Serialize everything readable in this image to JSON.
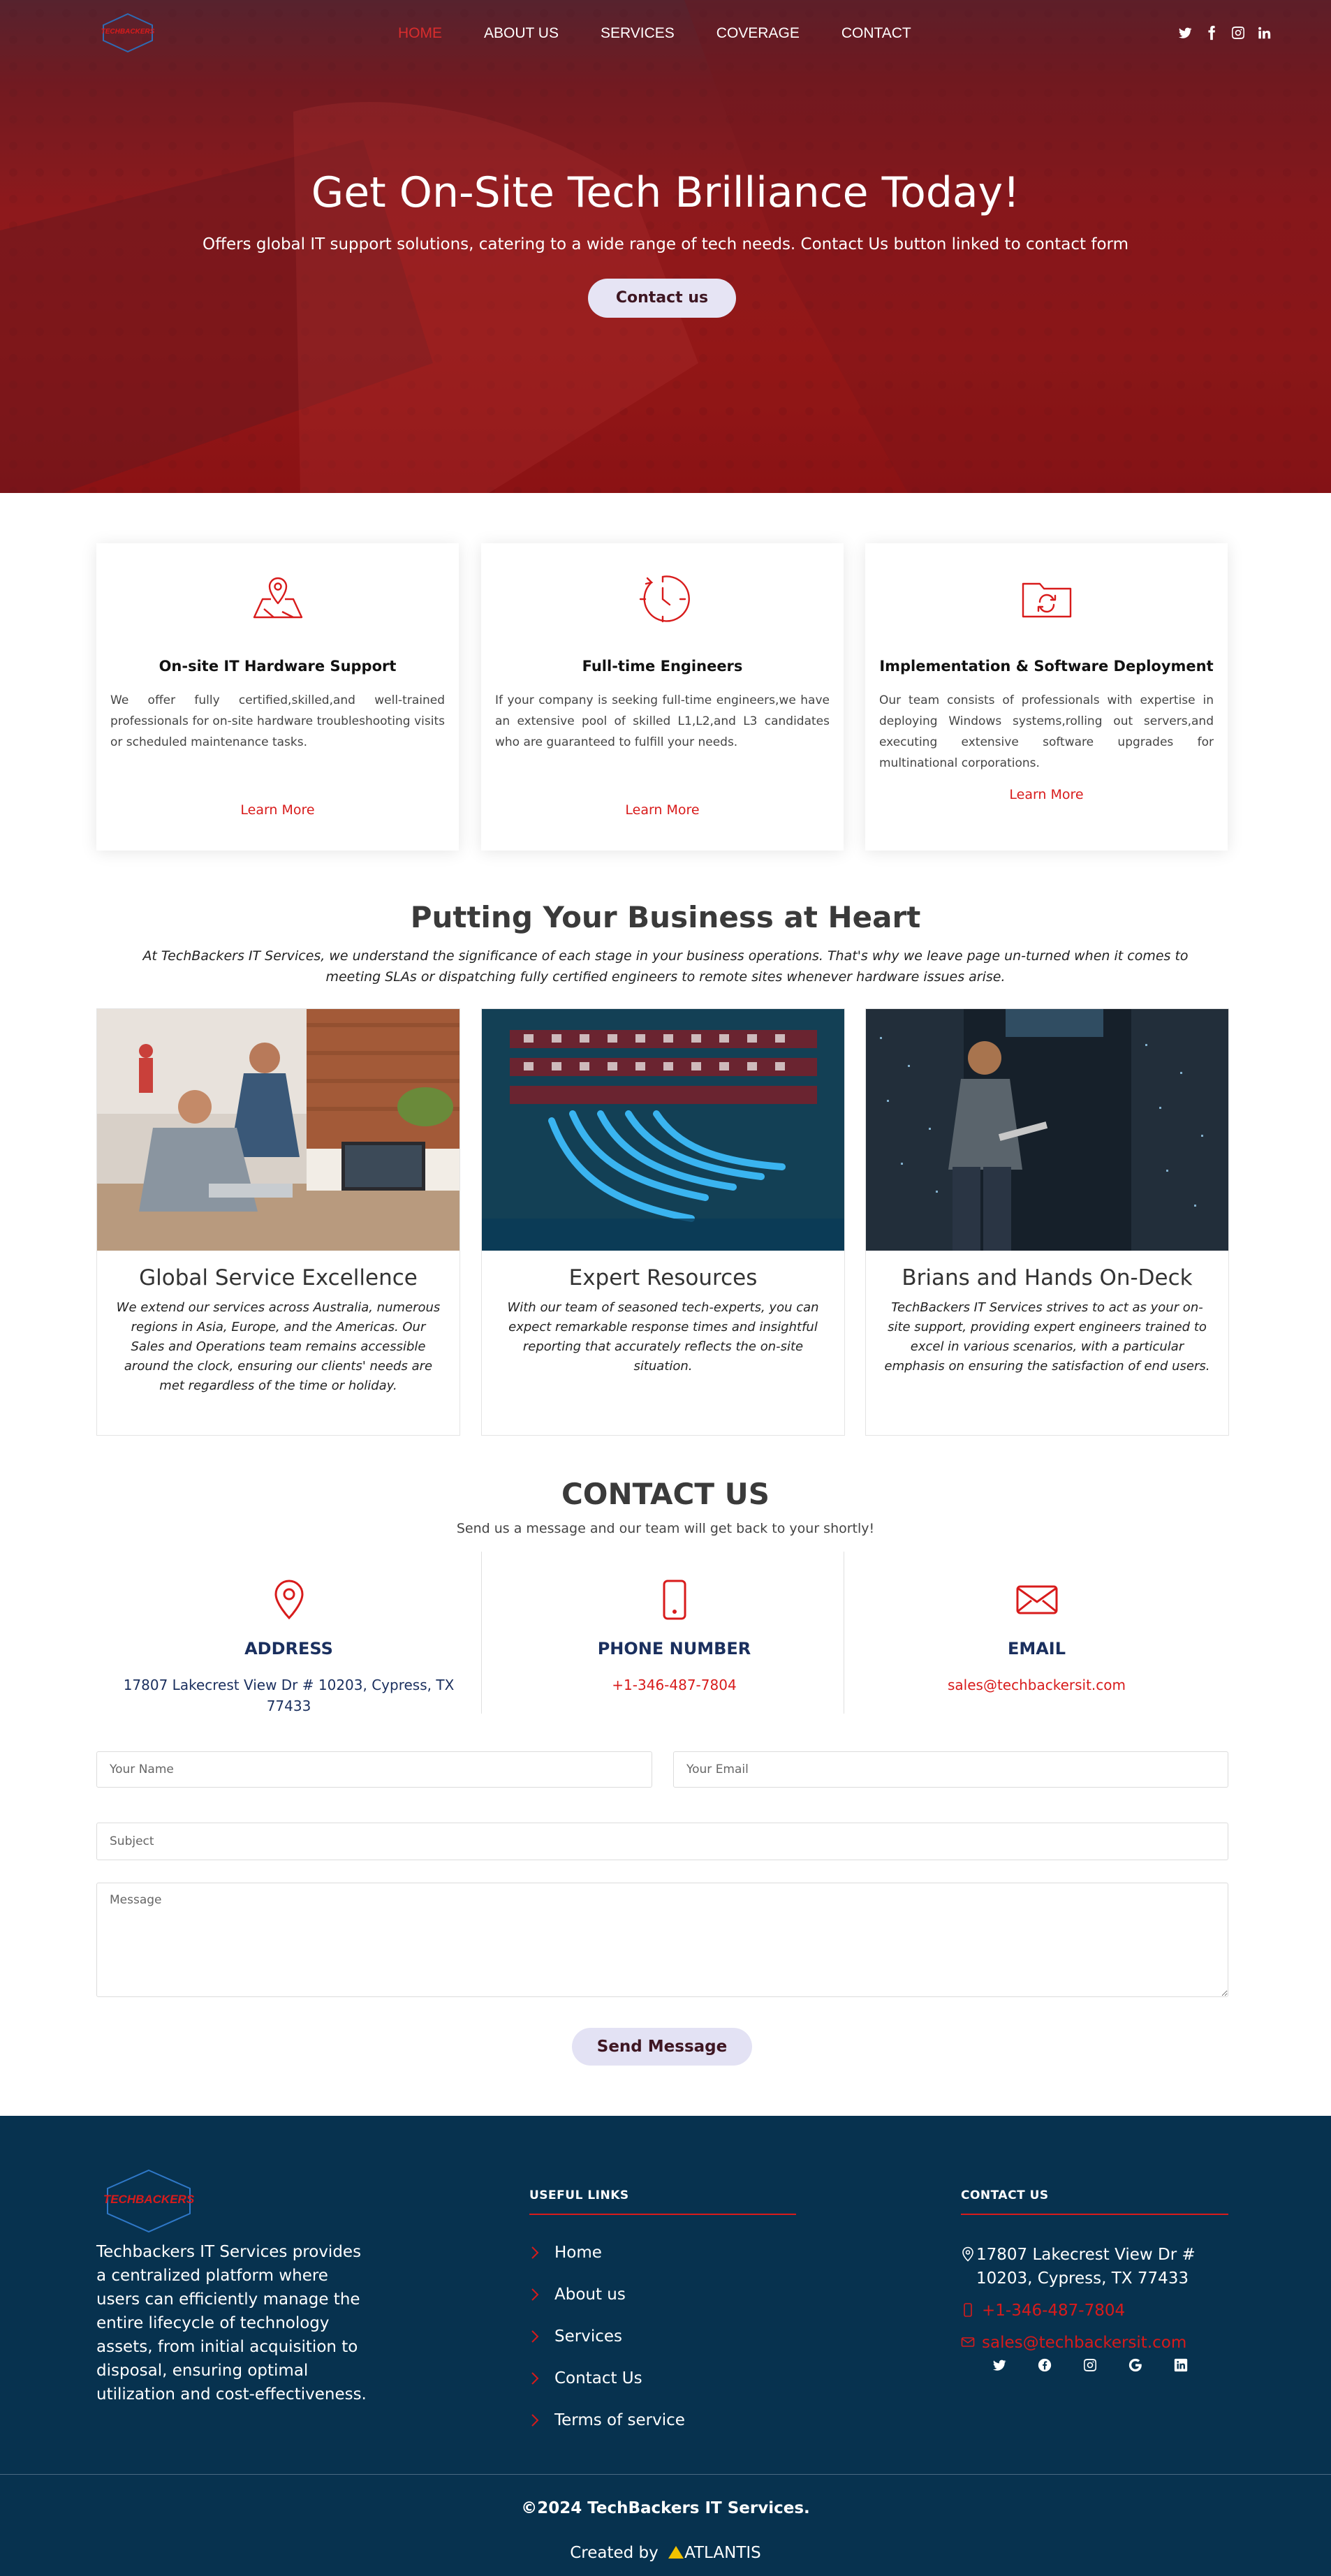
{
  "nav": {
    "logo_text": "TECHBACKERS",
    "items": [
      {
        "label": "HOME",
        "active": true
      },
      {
        "label": "ABOUT US",
        "active": false
      },
      {
        "label": "SERVICES",
        "active": false
      },
      {
        "label": "COVERAGE",
        "active": false
      },
      {
        "label": "CONTACT",
        "active": false
      }
    ],
    "social_icons": [
      "twitter-icon",
      "facebook-icon",
      "instagram-icon",
      "linkedin-icon"
    ]
  },
  "hero": {
    "title": "Get On-Site Tech Brilliance Today!",
    "subtitle": "Offers global IT support solutions, catering to a wide range of tech needs. Contact Us button linked to contact form",
    "button": "Contact us"
  },
  "services": [
    {
      "icon": "map-pin-icon",
      "title": "On-site IT Hardware Support",
      "text": "We offer fully certified,skilled,and well-trained professionals for on-site hardware troubleshooting visits or scheduled maintenance tasks.",
      "link": "Learn More"
    },
    {
      "icon": "clock-icon",
      "title": "Full-time Engineers",
      "text": "If your company is seeking full-time engineers,we have an extensive pool of skilled L1,L2,and L3 candidates who are guaranteed to fulfill your needs.",
      "link": "Learn More"
    },
    {
      "icon": "folder-sync-icon",
      "title": "Implementation & Software Deployment",
      "text": "Our team consists of professionals with expertise in deploying Windows systems,rolling out servers,and executing extensive software upgrades for multinational corporations.",
      "link": "Learn More"
    }
  ],
  "heart": {
    "title": "Putting Your Business at Heart",
    "description": "At TechBackers IT Services, we understand the significance of each stage in your business operations. That's why we leave page un-turned when it comes to meeting SLAs or dispatching fully certified engineers to remote sites whenever hardware issues arise.",
    "features": [
      {
        "title": "Global Service Excellence",
        "text": "We extend our services across Australia, numerous regions in Asia, Europe, and the Americas. Our Sales and Operations team remains accessible around the clock, ensuring our clients' needs are met regardless of the time or holiday."
      },
      {
        "title": "Expert Resources",
        "text": "With our team of seasoned tech-experts, you can expect remarkable response times and insightful reporting that accurately reflects the on-site situation."
      },
      {
        "title": "Brians and Hands On-Deck",
        "text": "TechBackers IT Services strives to act as your on-site support, providing expert engineers trained to excel in various scenarios, with a particular emphasis on ensuring the satisfaction of end users."
      }
    ]
  },
  "contact": {
    "title": "CONTACT US",
    "subtitle": "Send us a message and our team will get back to your shortly!",
    "address_label": "ADDRESS",
    "address_value": "17807 Lakecrest View Dr # 10203, Cypress, TX 77433",
    "phone_label": "PHONE NUMBER",
    "phone_value": "+1-346-487-7804",
    "email_label": "EMAIL",
    "email_value": "sales@techbackersit.com",
    "form": {
      "name_placeholder": "Your Name",
      "email_placeholder": "Your Email",
      "subject_placeholder": "Subject",
      "message_placeholder": "Message",
      "submit": "Send Message"
    }
  },
  "footer": {
    "logo_text": "TECHBACKERS",
    "about": "Techbackers IT Services provides a centralized platform where users can efficiently manage the entire lifecycle of technology assets, from initial acquisition to disposal, ensuring optimal utilization and cost-effectiveness.",
    "useful_links_title": "USEFUL LINKS",
    "links": [
      "Home",
      "About us",
      "Services",
      "Contact Us",
      "Terms of service"
    ],
    "contact_title": "CONTACT US",
    "address": "17807 Lakecrest View Dr # 10203, Cypress, TX 77433",
    "phone": "+1-346-487-7804",
    "email": "sales@techbackersit.com",
    "social_icons": [
      "twitter-icon",
      "facebook-icon",
      "instagram-icon",
      "google-icon",
      "linkedin-icon"
    ],
    "copyright": "©2024 TechBackers IT Services.",
    "credit_prefix": "Created by",
    "credit_brand": "ATLANTIS"
  },
  "colors": {
    "accent_red": "#d81b1b",
    "footer_bg": "#07324f",
    "button_bg": "#e3e2f4",
    "navy_text": "#1a2f5e"
  }
}
